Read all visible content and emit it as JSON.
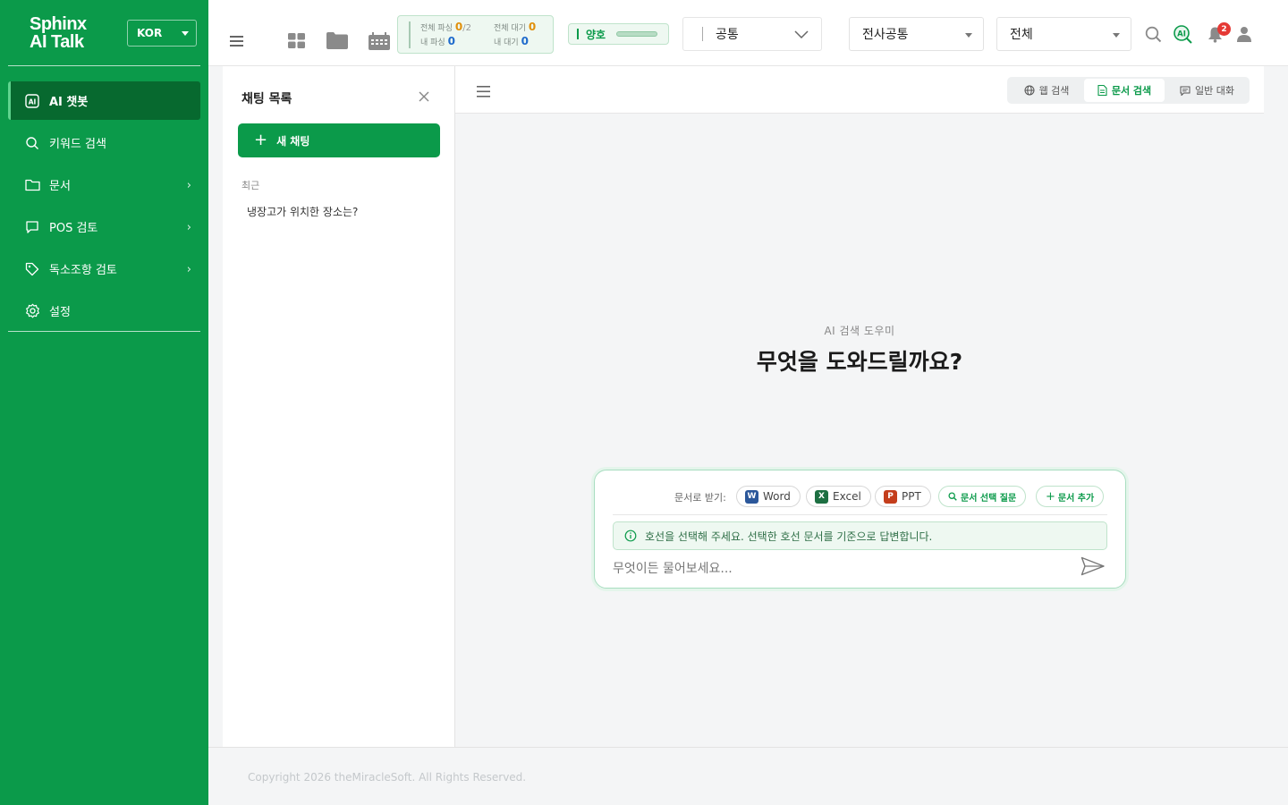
{
  "brand": {
    "line1": "Sphinx",
    "line2": "AI Talk"
  },
  "language": {
    "selected": "KOR"
  },
  "nav": {
    "items": [
      {
        "label": "AI 챗봇",
        "icon": "ai-icon",
        "active": true,
        "has_submenu": false
      },
      {
        "label": "키워드 검색",
        "icon": "search-icon",
        "active": false,
        "has_submenu": false
      },
      {
        "label": "문서",
        "icon": "folder-icon",
        "active": false,
        "has_submenu": true
      },
      {
        "label": "POS 검토",
        "icon": "chat-bubble-icon",
        "active": false,
        "has_submenu": true
      },
      {
        "label": "독소조항 검토",
        "icon": "tag-icon",
        "active": false,
        "has_submenu": true
      },
      {
        "label": "설정",
        "icon": "gear-icon",
        "active": false,
        "has_submenu": false
      }
    ]
  },
  "topbar": {
    "stats": {
      "total_parse_label": "전체 파싱",
      "total_parse_value": "0",
      "total_parse_total": "/2",
      "total_wait_label": "전체 대기",
      "total_wait_value": "0",
      "my_parse_label": "내 파싱",
      "my_parse_value": "0",
      "my_wait_label": "내 대기",
      "my_wait_value": "0"
    },
    "status": {
      "label": "양호"
    },
    "selects": {
      "scope": "공통",
      "company": "전사공통",
      "range": "전체"
    },
    "notifications_count": "2",
    "ai_badge": "AI"
  },
  "chat_panel": {
    "title": "채팅 목록",
    "new_chat_label": "새 채팅",
    "recent_label": "최근",
    "items": [
      "냉장고가 위치한 장소는?"
    ]
  },
  "modes": {
    "web": "웹 검색",
    "doc": "문서 검색",
    "general": "일반 대화",
    "active": "doc"
  },
  "hero": {
    "subtitle": "AI 검색 도우미",
    "title": "무엇을 도와드릴까요?"
  },
  "composer": {
    "receive_label": "문서로 받기:",
    "word_label": "Word",
    "excel_label": "Excel",
    "ppt_label": "PPT",
    "select_doc_label": "문서 선택 질문",
    "add_doc_label": "문서 추가",
    "notice": "호선을 선택해 주세요. 선택한 호선 문서를 기준으로 답변합니다.",
    "placeholder": "무엇이든 물어보세요..."
  },
  "footer": {
    "copyright": "Copyright 2026 theMiracleSoft. All Rights Reserved."
  },
  "colors": {
    "brand_green": "#0b9a4a",
    "active_nav": "#07692f",
    "warn_orange": "#e0900c",
    "info_blue": "#1f6bcc"
  }
}
